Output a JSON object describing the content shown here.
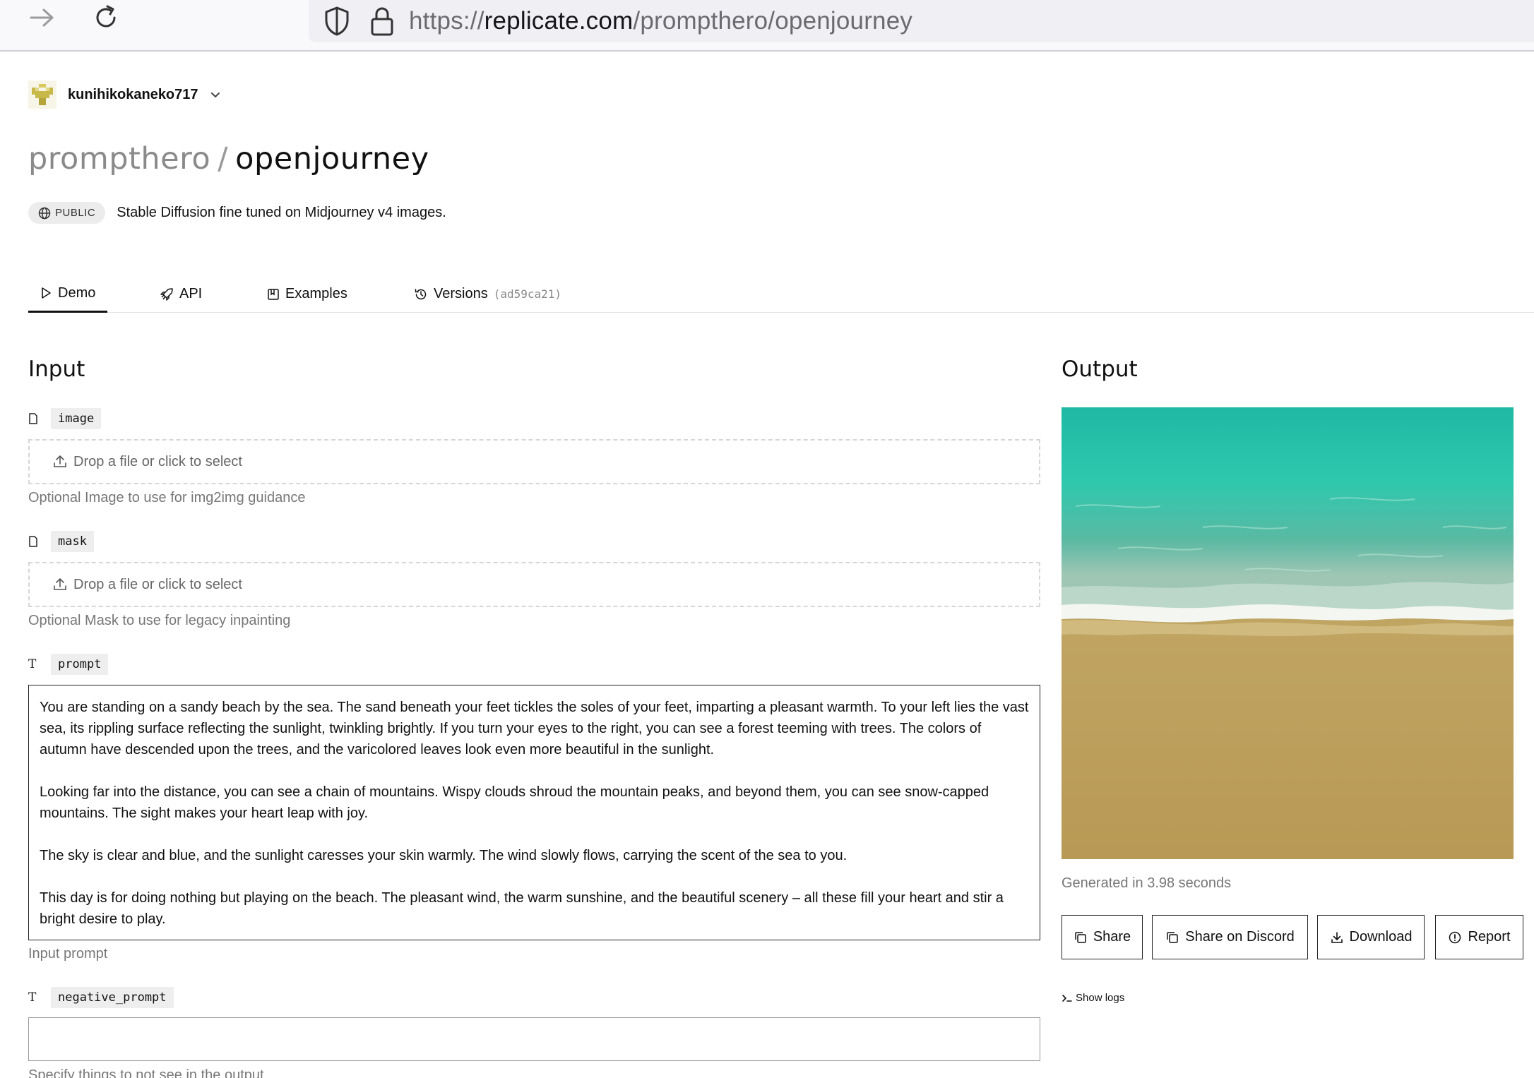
{
  "browser": {
    "url_scheme": "https://",
    "url_host": "replicate.com",
    "url_path": "/prompthero/openjourney"
  },
  "account": {
    "username": "kunihikokaneko717"
  },
  "model": {
    "owner": "prompthero",
    "separator": "/",
    "name": "openjourney",
    "visibility": "PUBLIC",
    "description": "Stable Diffusion fine tuned on Midjourney v4 images."
  },
  "tabs": [
    {
      "label": "Demo",
      "active": true
    },
    {
      "label": "API"
    },
    {
      "label": "Examples"
    },
    {
      "label": "Versions",
      "version": "(ad59ca21)"
    }
  ],
  "input": {
    "heading": "Input",
    "image": {
      "name": "image",
      "drop_text": "Drop a file or click to select",
      "hint": "Optional Image to use for img2img guidance"
    },
    "mask": {
      "name": "mask",
      "drop_text": "Drop a file or click to select",
      "hint": "Optional Mask to use for legacy inpainting"
    },
    "prompt": {
      "name": "prompt",
      "paragraphs": [
        "You are standing on a sandy beach by the sea. The sand beneath your feet tickles the soles of your feet, imparting a pleasant warmth. To your left lies the vast sea, its rippling surface reflecting the sunlight, twinkling brightly. If you turn your eyes to the right, you can see a forest teeming with trees. The colors of autumn have descended upon the trees, and the varicolored leaves look even more beautiful in the sunlight.",
        "Looking far into the distance, you can see a chain of mountains. Wispy clouds shroud the mountain peaks, and beyond them, you can see snow-capped mountains. The sight makes your heart leap with joy.",
        "The sky is clear and blue, and the sunlight caresses your skin warmly. The wind slowly flows, carrying the scent of the sea to you.",
        "This day is for doing nothing but playing on the beach. The pleasant wind, the warm sunshine, and the beautiful scenery – all these fill your heart and stir a bright desire to play."
      ],
      "hint": "Input prompt"
    },
    "negative_prompt": {
      "name": "negative_prompt",
      "value": "",
      "hint": "Specify things to not see in the output"
    }
  },
  "output": {
    "heading": "Output",
    "generated": "Generated in 3.98 seconds",
    "buttons": {
      "share": "Share",
      "discord": "Share on Discord",
      "download": "Download",
      "report": "Report"
    },
    "logs": "Show logs"
  }
}
